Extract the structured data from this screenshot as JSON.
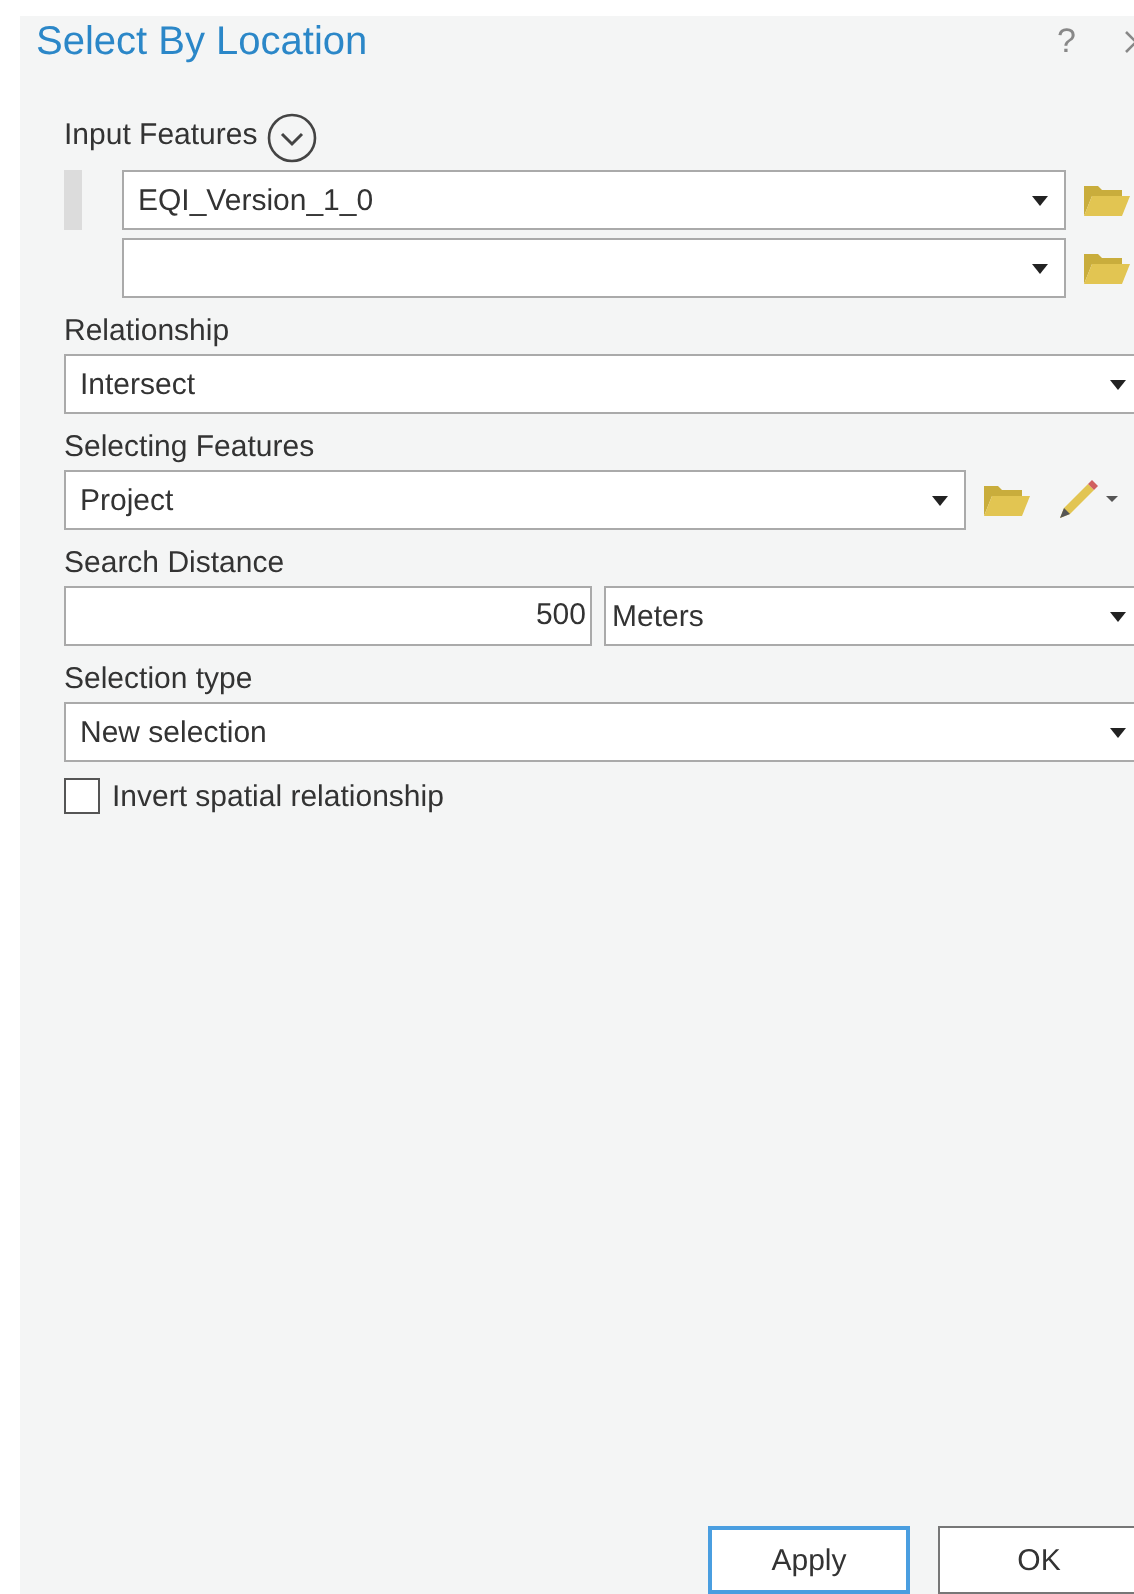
{
  "title": "Select By Location",
  "help": "?",
  "parameters": [
    {
      "kind": "layer_list",
      "label": "Input Features",
      "rows": [
        {
          "value": "EQI_Version_1_0"
        },
        {}
      ]
    },
    {
      "kind": "dropdown",
      "label": "Relationship",
      "value": "Intersect"
    },
    {
      "kind": "layer_dropdown",
      "label": "Selecting Features",
      "value": "Project"
    },
    {
      "kind": "distance",
      "label": "Search Distance",
      "value": "500",
      "unit": "Meters"
    },
    {
      "kind": "dropdown",
      "label": "Selection type",
      "value": "New selection"
    },
    {
      "kind": "checkbox",
      "label": "Invert spatial relationship",
      "checked": false
    }
  ],
  "buttons": [
    {
      "label": "Apply",
      "selected": true
    },
    {
      "label": "OK",
      "selected": false
    }
  ]
}
